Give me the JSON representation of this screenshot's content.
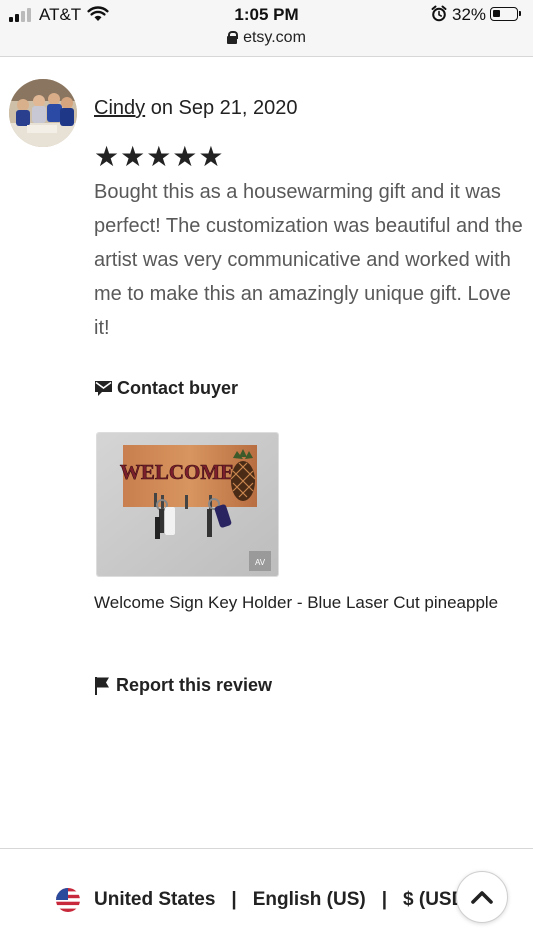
{
  "status_bar": {
    "carrier": "AT&T",
    "time": "1:05 PM",
    "battery_percent": "32%",
    "battery_level": 0.32,
    "icons": [
      "signal-icon",
      "wifi-icon",
      "alarm-icon",
      "battery-icon"
    ]
  },
  "browser": {
    "url": "etsy.com",
    "lock_icon": "lock-icon"
  },
  "review": {
    "reviewer_name": "Cindy",
    "date_text": " on Sep 21, 2020",
    "rating": 5,
    "stars": "★★★★★",
    "text": "Bought this as a housewarming gift and it was perfect! The customization was beautiful and the artist was very communicative and worked with me to make this an amazingly unique gift. Love it!",
    "contact_label": "Contact buyer",
    "contact_icon": "envelope-icon",
    "photo_sign_text": "WELCOME",
    "photo_watermark": "AV",
    "item_title": "Welcome Sign Key Holder - Blue Laser Cut pineapple",
    "report_label": "Report this review",
    "report_icon": "flag-icon"
  },
  "footer": {
    "region": "United States",
    "language": "English (US)",
    "currency": "$ (USD)",
    "separator": "|",
    "region_icon": "us-flag-icon",
    "scroll_icon": "chevron-up-icon"
  },
  "colors": {
    "text_primary": "#222222",
    "text_review": "#595959",
    "topbar_bg": "#f6f6f6"
  }
}
